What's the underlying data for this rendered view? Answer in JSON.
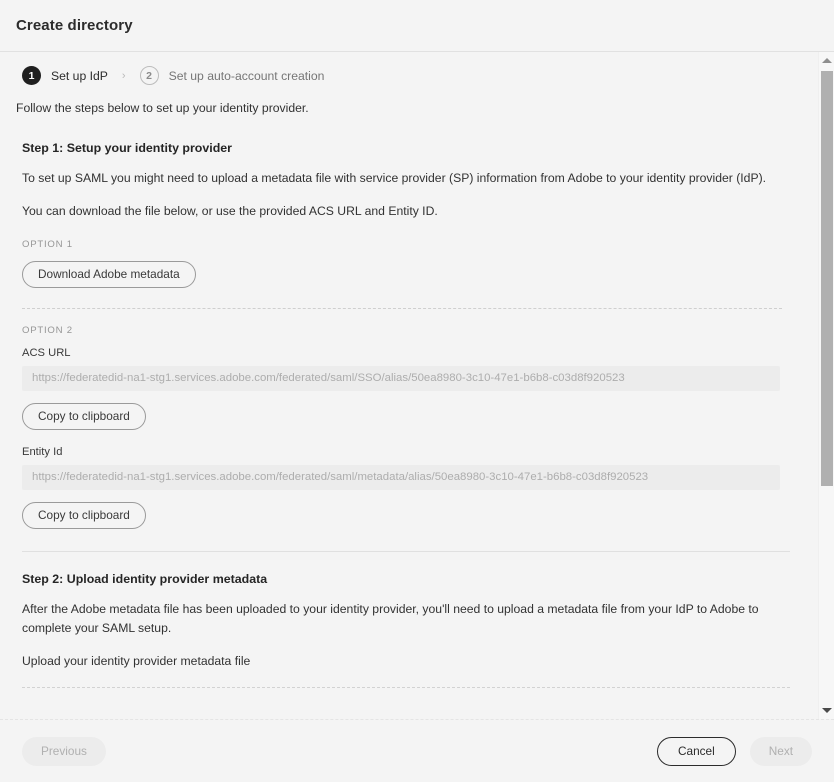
{
  "window": {
    "title": "Create directory"
  },
  "stepper": {
    "separator": "›",
    "steps": [
      {
        "number": "1",
        "label": "Set up IdP",
        "state": "active"
      },
      {
        "number": "2",
        "label": "Set up auto-account creation",
        "state": "inactive"
      }
    ]
  },
  "lead": "Follow the steps below to set up your identity provider.",
  "step1": {
    "heading": "Step 1: Setup your identity provider",
    "paragraph1": "To set up SAML you might need to upload a metadata file with service provider (SP) information from Adobe to your identity provider (IdP).",
    "paragraph2": "You can download the file below, or use the provided ACS URL and Entity ID.",
    "option1": {
      "label": "OPTION 1",
      "download_button": "Download Adobe metadata"
    },
    "option2": {
      "label": "OPTION 2",
      "acs": {
        "field_label": "ACS URL",
        "value": "https://federatedid-na1-stg1.services.adobe.com/federated/saml/SSO/alias/50ea8980-3c10-47e1-b6b8-c03d8f920523",
        "copy_button": "Copy to clipboard"
      },
      "entity": {
        "field_label": "Entity Id",
        "value": "https://federatedid-na1-stg1.services.adobe.com/federated/saml/metadata/alias/50ea8980-3c10-47e1-b6b8-c03d8f920523",
        "copy_button": "Copy to clipboard"
      }
    }
  },
  "step2": {
    "heading": "Step 2: Upload identity provider metadata",
    "paragraph1": "After the Adobe metadata file has been uploaded to your identity provider, you'll need to upload a metadata file from your IdP to Adobe to complete your SAML setup.",
    "upload_label": "Upload your identity provider metadata file"
  },
  "footer": {
    "previous": "Previous",
    "cancel": "Cancel",
    "next": "Next"
  },
  "scrollbar": {
    "up_arrow_icon": "chevron-up-icon",
    "down_arrow_icon": "chevron-down-icon"
  },
  "colors": {
    "background": "#f4f4f4",
    "field_background": "#ececec",
    "accent_dark": "#1f1f1f",
    "muted_text": "#969696"
  }
}
